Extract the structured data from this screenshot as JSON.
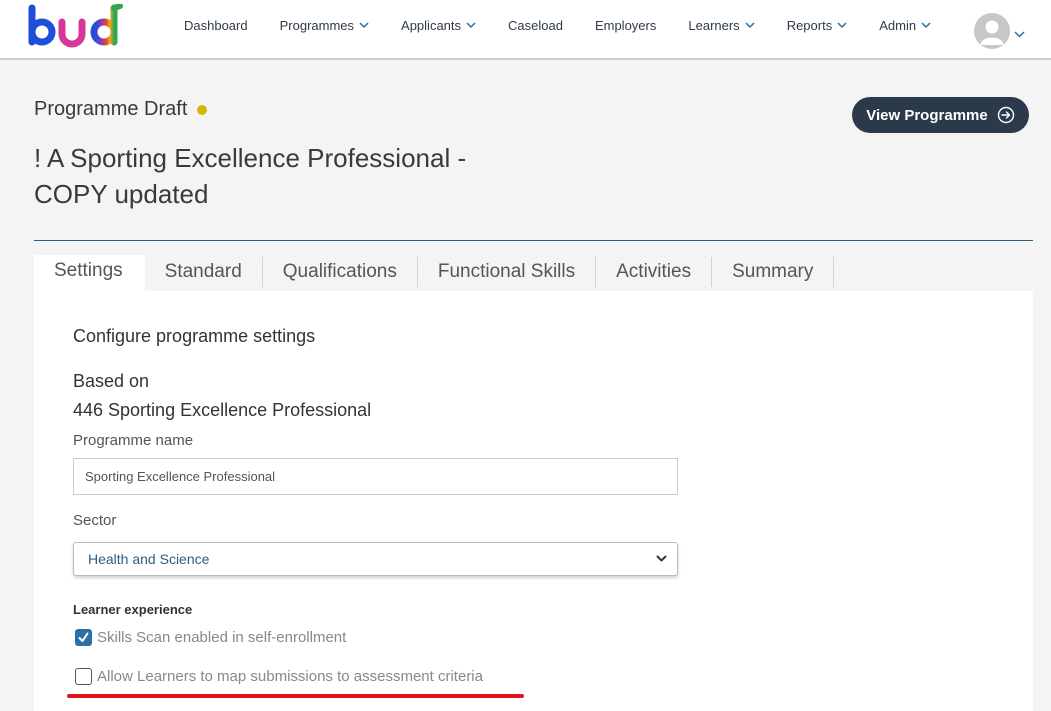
{
  "nav": {
    "items": [
      {
        "label": "Dashboard",
        "has_dropdown": false
      },
      {
        "label": "Programmes",
        "has_dropdown": true
      },
      {
        "label": "Applicants",
        "has_dropdown": true
      },
      {
        "label": "Caseload",
        "has_dropdown": false
      },
      {
        "label": "Employers",
        "has_dropdown": false
      },
      {
        "label": "Learners",
        "has_dropdown": true
      },
      {
        "label": "Reports",
        "has_dropdown": true
      },
      {
        "label": "Admin",
        "has_dropdown": true
      }
    ],
    "logo_icon": "bud-logo",
    "avatar_icon": "user-avatar-icon"
  },
  "header": {
    "status_label": "Programme Draft",
    "status_color": "#d4b800",
    "title": "! A Sporting Excellence Professional - COPY updated",
    "view_button_label": "View Programme"
  },
  "tabs": [
    {
      "label": "Settings",
      "active": true
    },
    {
      "label": "Standard",
      "active": false
    },
    {
      "label": "Qualifications",
      "active": false
    },
    {
      "label": "Functional Skills",
      "active": false
    },
    {
      "label": "Activities",
      "active": false
    },
    {
      "label": "Summary",
      "active": false
    }
  ],
  "settings": {
    "section_title": "Configure programme settings",
    "based_on_label": "Based on",
    "based_on_value": "446 Sporting Excellence Professional",
    "programme_name_label": "Programme name",
    "programme_name_value": "Sporting Excellence Professional",
    "sector_label": "Sector",
    "sector_value": "Health and Science",
    "learner_experience_label": "Learner experience",
    "options": [
      {
        "label": "Skills Scan enabled in self-enrollment",
        "checked": true
      },
      {
        "label": "Allow Learners to map submissions to assessment criteria",
        "checked": false
      }
    ]
  },
  "colors": {
    "primary_dark": "#2b3a4b",
    "accent_blue": "#2c6fa5",
    "highlight_red": "#e0161e"
  }
}
